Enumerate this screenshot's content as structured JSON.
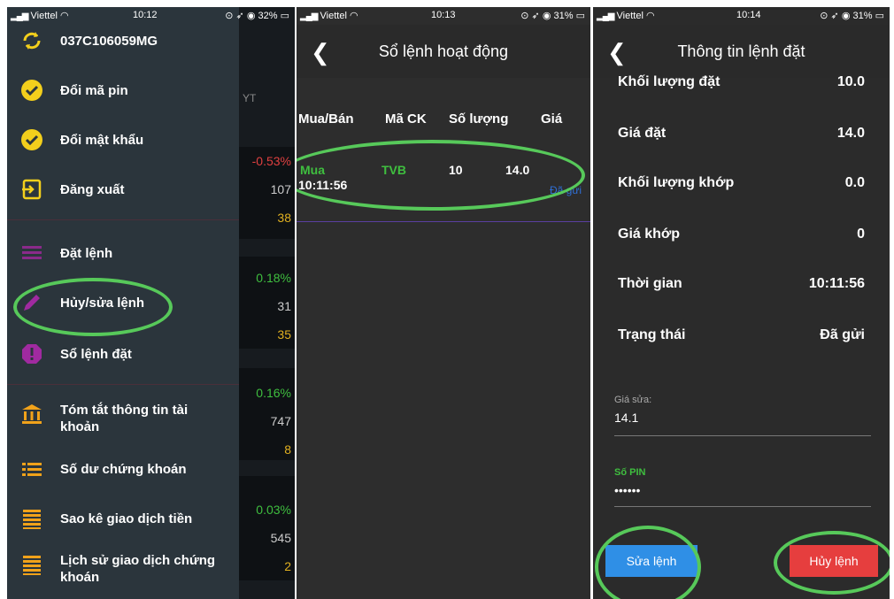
{
  "panel1": {
    "status": {
      "carrier": "Viettel",
      "time": "10:12",
      "battery": "32%"
    },
    "account": "037C106059MG",
    "menu": [
      {
        "label": "Đổi mã pin"
      },
      {
        "label": "Đổi mật khẩu"
      },
      {
        "label": "Đăng xuất"
      },
      {
        "label": "Đặt lệnh"
      },
      {
        "label": "Hủy/sửa lệnh"
      },
      {
        "label": "Sổ lệnh đặt"
      },
      {
        "label": "Tóm tắt thông tin tài khoản"
      },
      {
        "label": "Số dư chứng khoán"
      },
      {
        "label": "Sao kê giao dịch tiền"
      },
      {
        "label": "Lịch sử giao dịch chứng khoán"
      }
    ],
    "behind": {
      "header": "YT",
      "values": [
        "-0.53%",
        "107",
        "38",
        "0.18%",
        "31",
        "35",
        "0.16%",
        "747",
        "8",
        "0.03%",
        "545",
        "2"
      ]
    }
  },
  "panel2": {
    "status": {
      "carrier": "Viettel",
      "time": "10:13",
      "battery": "31%"
    },
    "title": "Sổ lệnh hoạt động",
    "columns": [
      "Mua/Bán",
      "Mã CK",
      "Số lượng",
      "Giá"
    ],
    "row": {
      "side": "Mua",
      "time": "10:11:56",
      "symbol": "TVB",
      "qty": "10",
      "price": "14.0",
      "status": "Đã gửi"
    }
  },
  "panel3": {
    "status": {
      "carrier": "Viettel",
      "time": "10:14",
      "battery": "31%"
    },
    "title": "Thông tin lệnh đặt",
    "details": [
      {
        "label": "Khối lượng đặt",
        "value": "10.0"
      },
      {
        "label": "Giá đặt",
        "value": "14.0"
      },
      {
        "label": "Khối lượng khớp",
        "value": "0.0"
      },
      {
        "label": "Giá khớp",
        "value": "0"
      },
      {
        "label": "Thời gian",
        "value": "10:11:56"
      },
      {
        "label": "Trạng thái",
        "value": "Đã gửi"
      }
    ],
    "price_field": {
      "label": "Giá sửa:",
      "value": "14.1"
    },
    "pin_field": {
      "label": "Số PIN",
      "value": "••••••"
    },
    "edit_button": "Sửa lệnh",
    "cancel_button": "Hủy lệnh"
  },
  "colors": {
    "green": "#3fbf3f",
    "highlight": "#57c95a",
    "yellow": "#f3cf1c",
    "purple": "#8a2a8a",
    "blue": "#2f8fe6",
    "red": "#e63e3e",
    "orange": "#f1a21a"
  }
}
